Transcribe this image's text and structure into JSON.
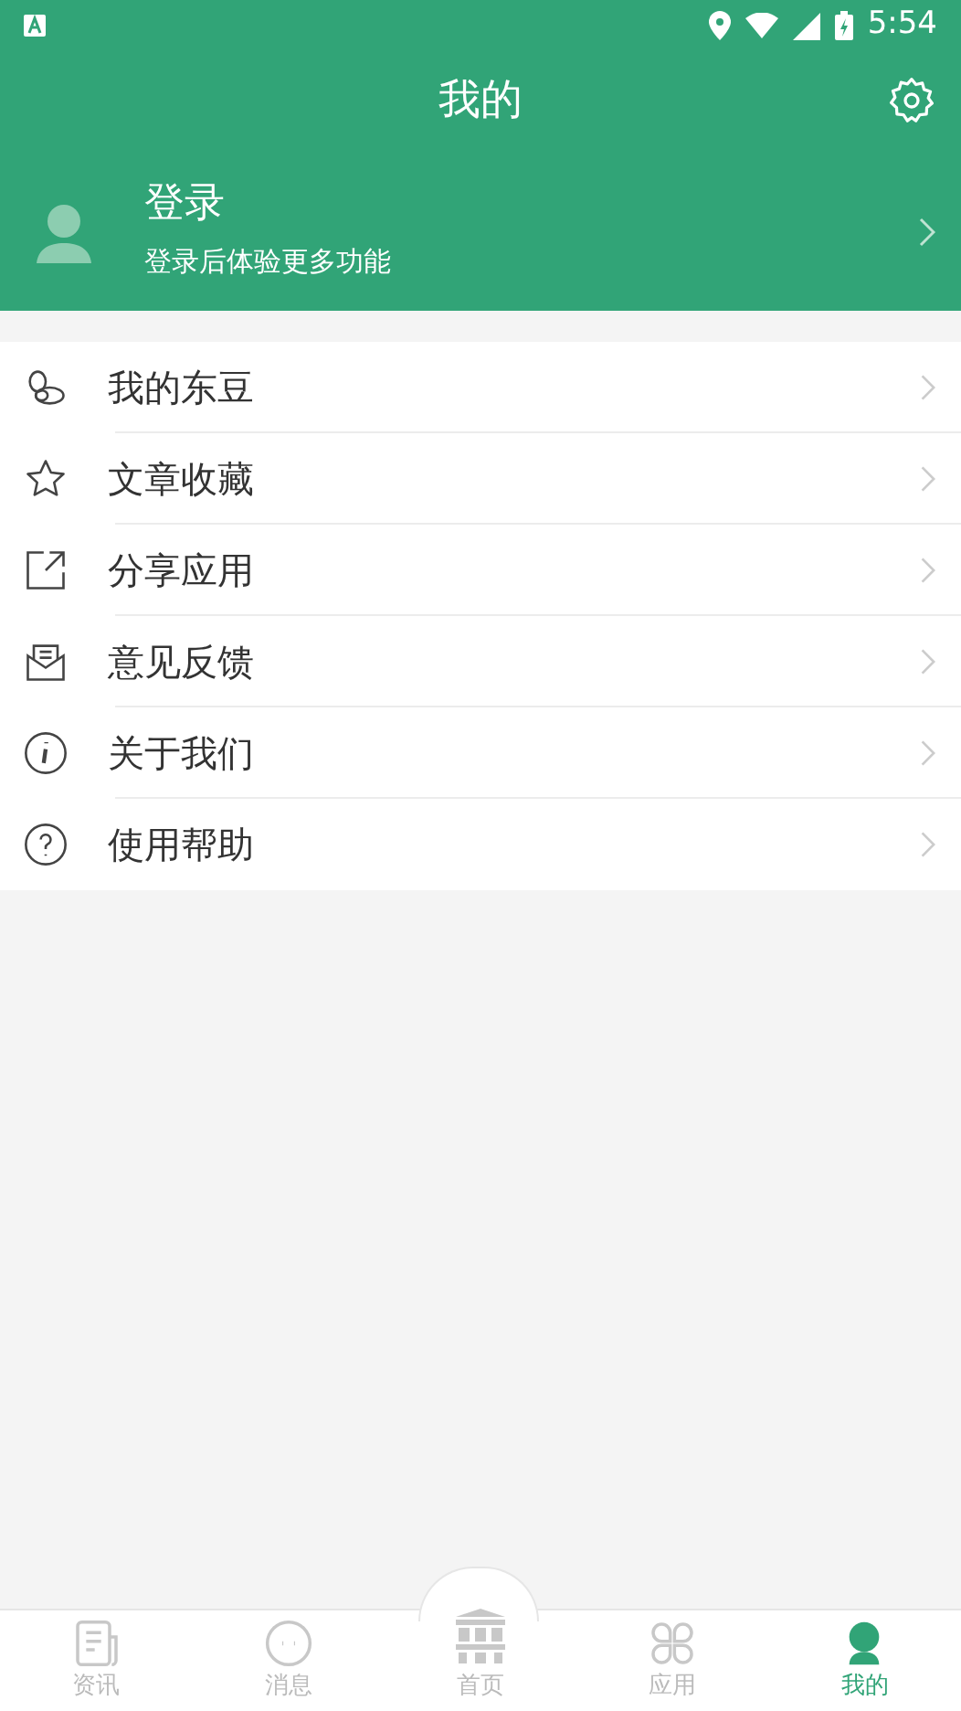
{
  "status_bar": {
    "time": "5:54"
  },
  "header": {
    "title": "我的"
  },
  "profile": {
    "name": "登录",
    "subtitle": "登录后体验更多功能"
  },
  "menu": [
    {
      "kind": "beans",
      "label": "我的东豆"
    },
    {
      "kind": "star",
      "label": "文章收藏"
    },
    {
      "kind": "share",
      "label": "分享应用"
    },
    {
      "kind": "mail",
      "label": "意见反馈"
    },
    {
      "kind": "info",
      "label": "关于我们"
    },
    {
      "kind": "help",
      "label": "使用帮助"
    }
  ],
  "tabs": [
    {
      "kind": "news",
      "label": "资讯",
      "selected": false
    },
    {
      "kind": "chat",
      "label": "消息",
      "selected": false
    },
    {
      "kind": "home",
      "label": "首页",
      "selected": false
    },
    {
      "kind": "apps",
      "label": "应用",
      "selected": false
    },
    {
      "kind": "me",
      "label": "我的",
      "selected": true
    }
  ]
}
